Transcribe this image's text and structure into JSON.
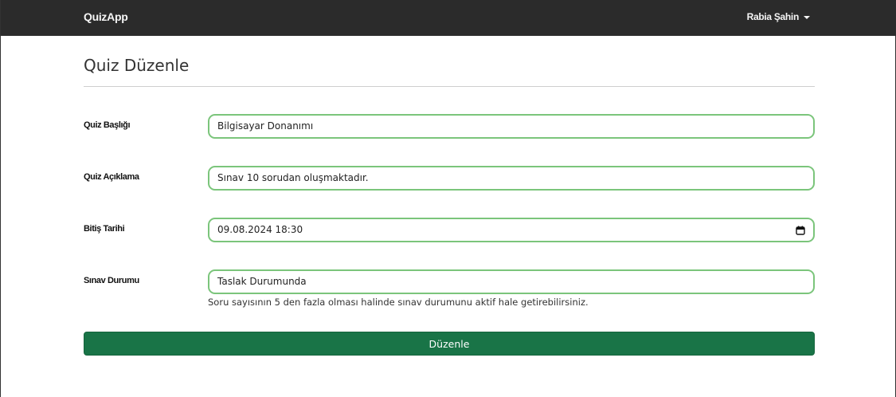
{
  "navbar": {
    "brand": "QuizApp",
    "user_name": "Rabia Şahin",
    "user_menu_icon": "caret-down-icon"
  },
  "page": {
    "title": "Quiz Düzenle"
  },
  "form": {
    "title_label": "Quiz Başlığı",
    "title_value": "Bilgisayar Donanımı",
    "description_label": "Quiz Açıklama",
    "description_value": "Sınav 10 sorudan oluşmaktadır.",
    "end_date_label": "Bitiş Tarihi",
    "end_date_value": "09.08.2024 18:30",
    "end_date_icon": "calendar-icon",
    "status_label": "Sınav Durumu",
    "status_value": "Taslak Durumunda",
    "status_help": "Soru sayısının 5 den fazla olması halinde sınav durumunu aktif hale getirebilirsiniz.",
    "submit_label": "Düzenle"
  },
  "colors": {
    "navbar": "#2b2b2b",
    "field_border": "#7bc57b",
    "button": "#197447"
  }
}
